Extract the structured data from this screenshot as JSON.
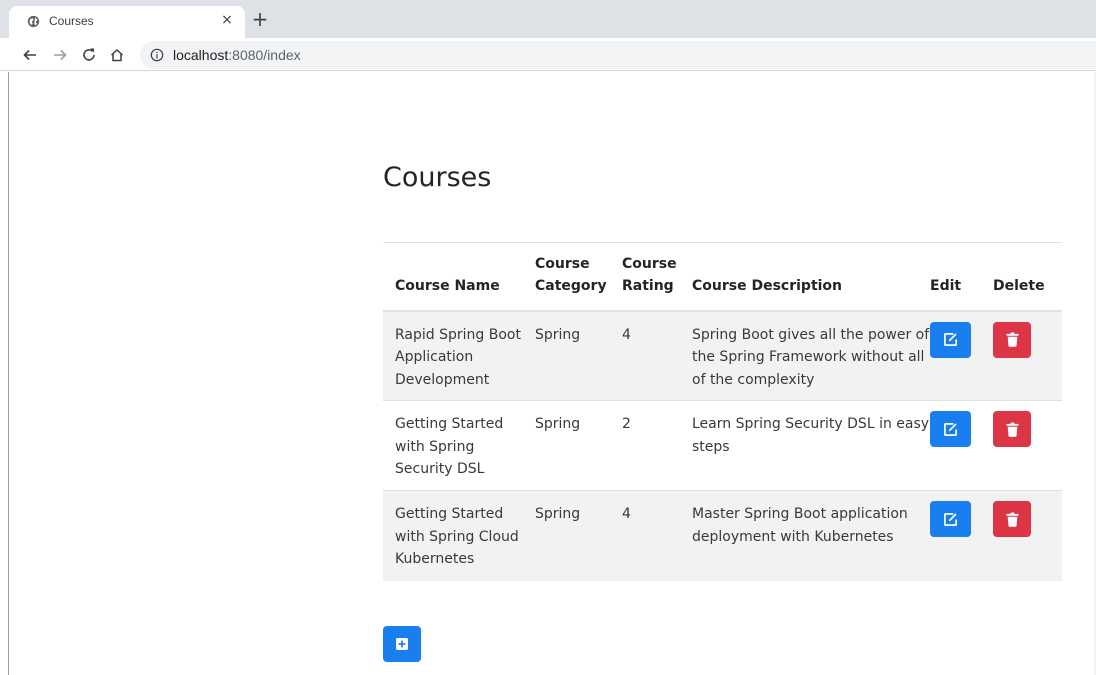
{
  "browser": {
    "tab_title": "Courses",
    "tab_close": "×",
    "new_tab": "+",
    "url_host": "localhost",
    "url_path": ":8080/index"
  },
  "page": {
    "heading": "Courses"
  },
  "table": {
    "headers": {
      "name": "Course Name",
      "category_line1": "Course",
      "category_line2": "Category",
      "rating_line1": "Course",
      "rating_line2": "Rating",
      "description": "Course Description",
      "edit": "Edit",
      "delete": "Delete"
    },
    "rows": [
      {
        "name": "Rapid Spring Boot Application Development",
        "category": "Spring",
        "rating": "4",
        "description": "Spring Boot gives all the power of the Spring Framework without all of the complexity"
      },
      {
        "name": "Getting Started with Spring Security DSL",
        "category": "Spring",
        "rating": "2",
        "description": "Learn Spring Security DSL in easy steps"
      },
      {
        "name": "Getting Started with Spring Cloud Kubernetes",
        "category": "Spring",
        "rating": "4",
        "description": "Master Spring Boot application deployment with Kubernetes"
      }
    ]
  },
  "icons": {
    "edit": "edit-icon",
    "delete": "trash-icon",
    "add": "plus-square-icon"
  },
  "colors": {
    "primary": "#1a7fee",
    "danger": "#dc3545",
    "stripe": "#f2f2f2"
  }
}
